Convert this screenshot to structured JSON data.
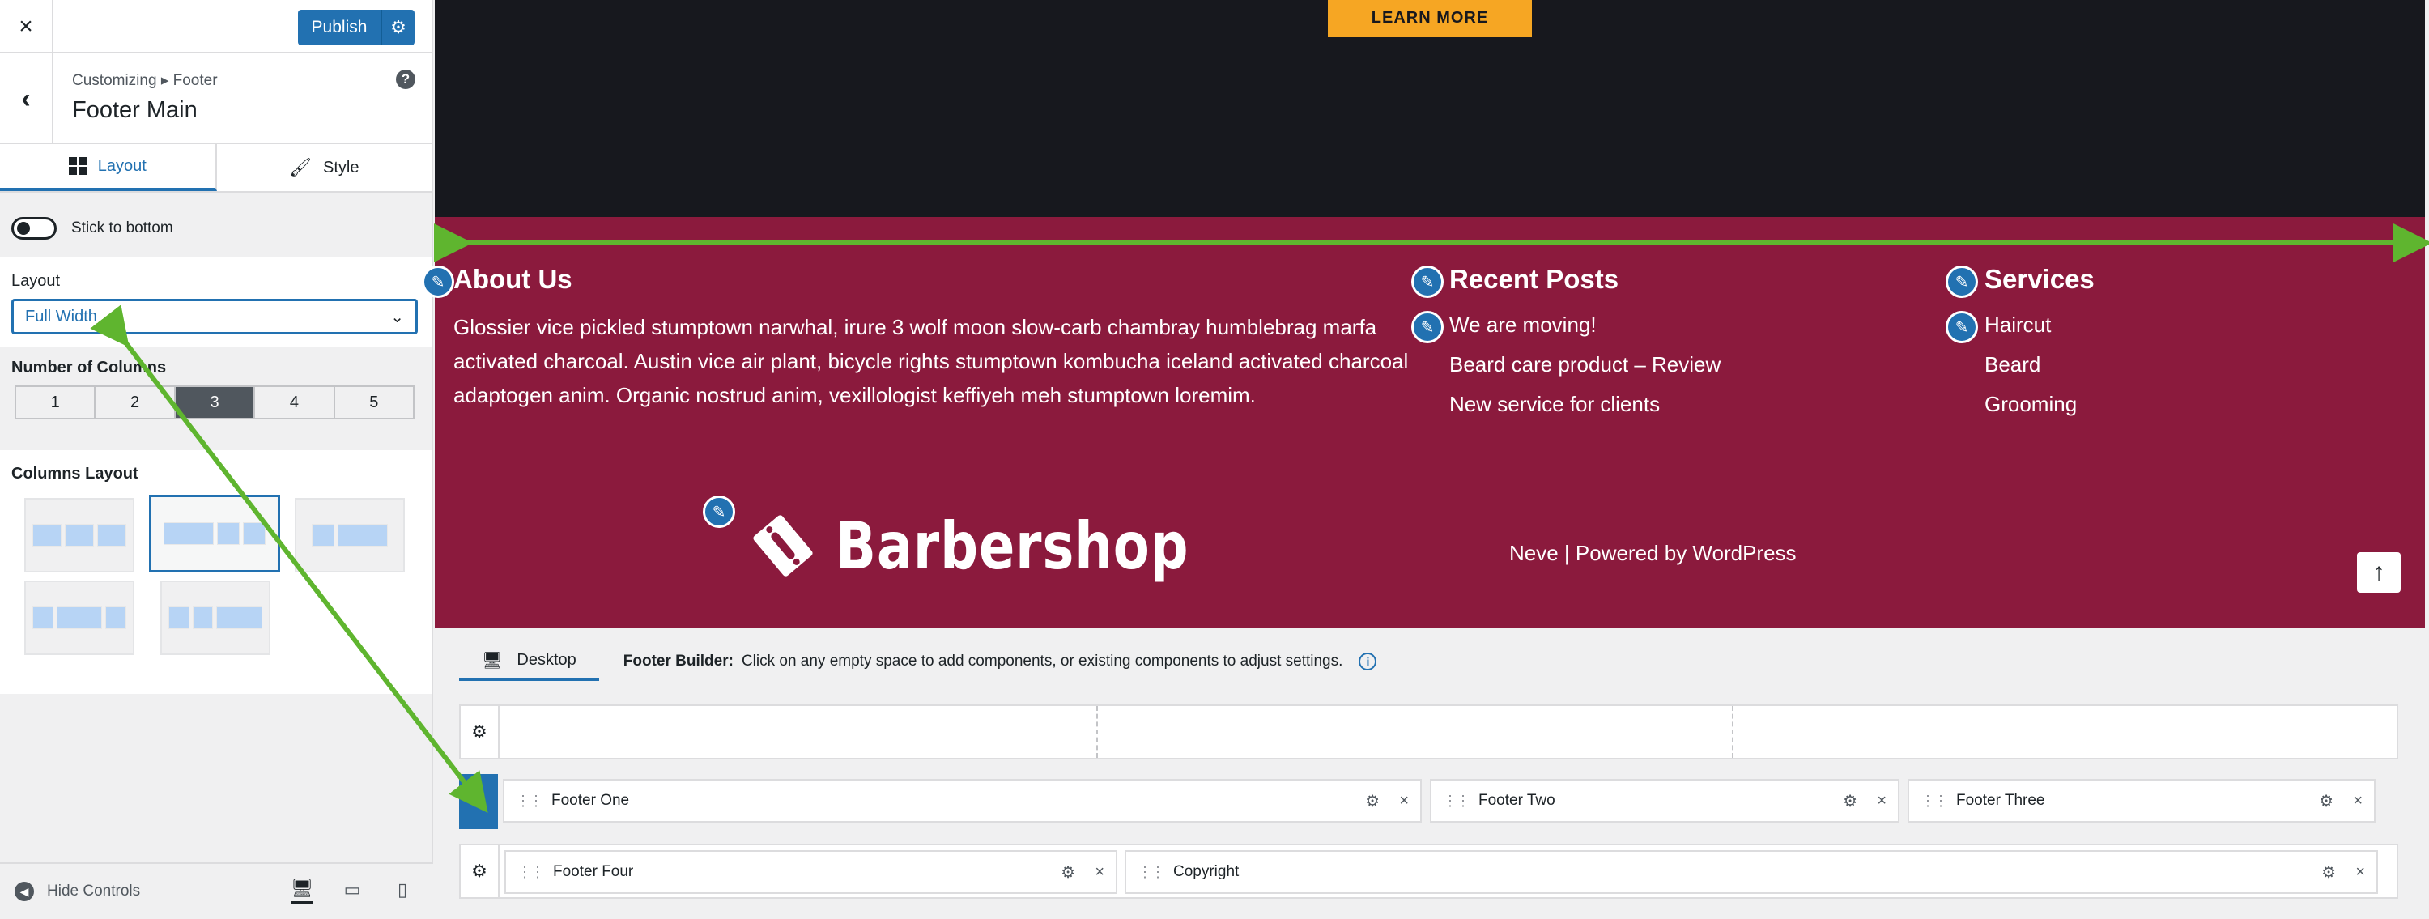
{
  "sidebar": {
    "close_label": "×",
    "publish_label": "Publish",
    "breadcrumb": "Customizing ▸ Footer",
    "section_title": "Footer Main",
    "tabs": [
      {
        "label": "Layout",
        "icon": "layout-grid-icon"
      },
      {
        "label": "Style",
        "icon": "brush-icon"
      }
    ],
    "stick_to_bottom_label": "Stick to bottom",
    "layout_label": "Layout",
    "layout_value": "Full Width",
    "columns_label": "Number of Columns",
    "columns": [
      "1",
      "2",
      "3",
      "4",
      "5"
    ],
    "columns_selected": "3",
    "columns_layout_label": "Columns Layout",
    "hide_controls_label": "Hide Controls"
  },
  "preview": {
    "hero_button": "LEARN MORE",
    "about_title": "About Us",
    "about_text": "Glossier vice pickled stumptown narwhal, irure 3 wolf moon slow-carb chambray humblebrag marfa activated charcoal. Austin vice air plant, bicycle rights stumptown kombucha iceland activated charcoal adaptogen anim. Organic nostrud anim, vexillologist keffiyeh meh stumptown loremim.",
    "posts_title": "Recent Posts",
    "posts": [
      "We are moving!",
      "Beard care product – Review",
      "New service for clients"
    ],
    "services_title": "Services",
    "services": [
      "Haircut",
      "Beard",
      "Grooming"
    ],
    "brand": "Barbershop",
    "powered_by": "Neve | Powered by WordPress",
    "colors": {
      "footer_bg": "#8b1a3d",
      "hero_bg": "#17181e",
      "accent": "#f6a623",
      "wp_blue": "#2271b1",
      "arrow": "#5fb52f"
    }
  },
  "builder": {
    "device_tab": "Desktop",
    "info_bold": "Footer Builder:",
    "info_text": "Click on any empty space to add components, or existing components to adjust settings.",
    "row2": [
      "Footer One",
      "Footer Two",
      "Footer Three"
    ],
    "row3": [
      "Footer Four",
      "Copyright"
    ]
  }
}
